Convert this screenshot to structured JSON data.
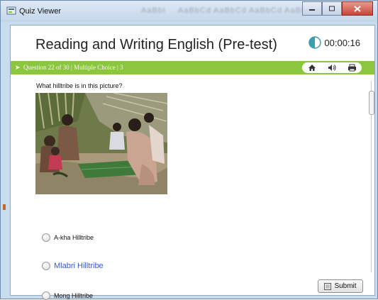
{
  "window": {
    "title": "Quiz Viewer",
    "ghost_text": [
      "AaBbI",
      "AaBbCd",
      "AaBbCd",
      "AaBbCd",
      "AaBbCd"
    ]
  },
  "quiz": {
    "title": "Reading and Writing English (Pre-test)",
    "timer": "00:00:16",
    "question_bar": "Question 22 of 30 | Multiple Choice | 3"
  },
  "question": {
    "text": "What hilltribe is in this picture?",
    "options": [
      {
        "label": "A-kha Hilltribe",
        "selected": false
      },
      {
        "label": "Mlabri Hilltribe",
        "selected": false
      },
      {
        "label": "Mong Hilltribe",
        "selected": false
      }
    ]
  },
  "buttons": {
    "submit": "Submit"
  },
  "colors": {
    "accent_green": "#8cc63f",
    "option_highlight": "#3a58c7"
  },
  "icons": [
    "quiz-viewer-icon",
    "timer-icon",
    "home-icon",
    "speaker-icon",
    "print-icon",
    "submit-icon"
  ]
}
